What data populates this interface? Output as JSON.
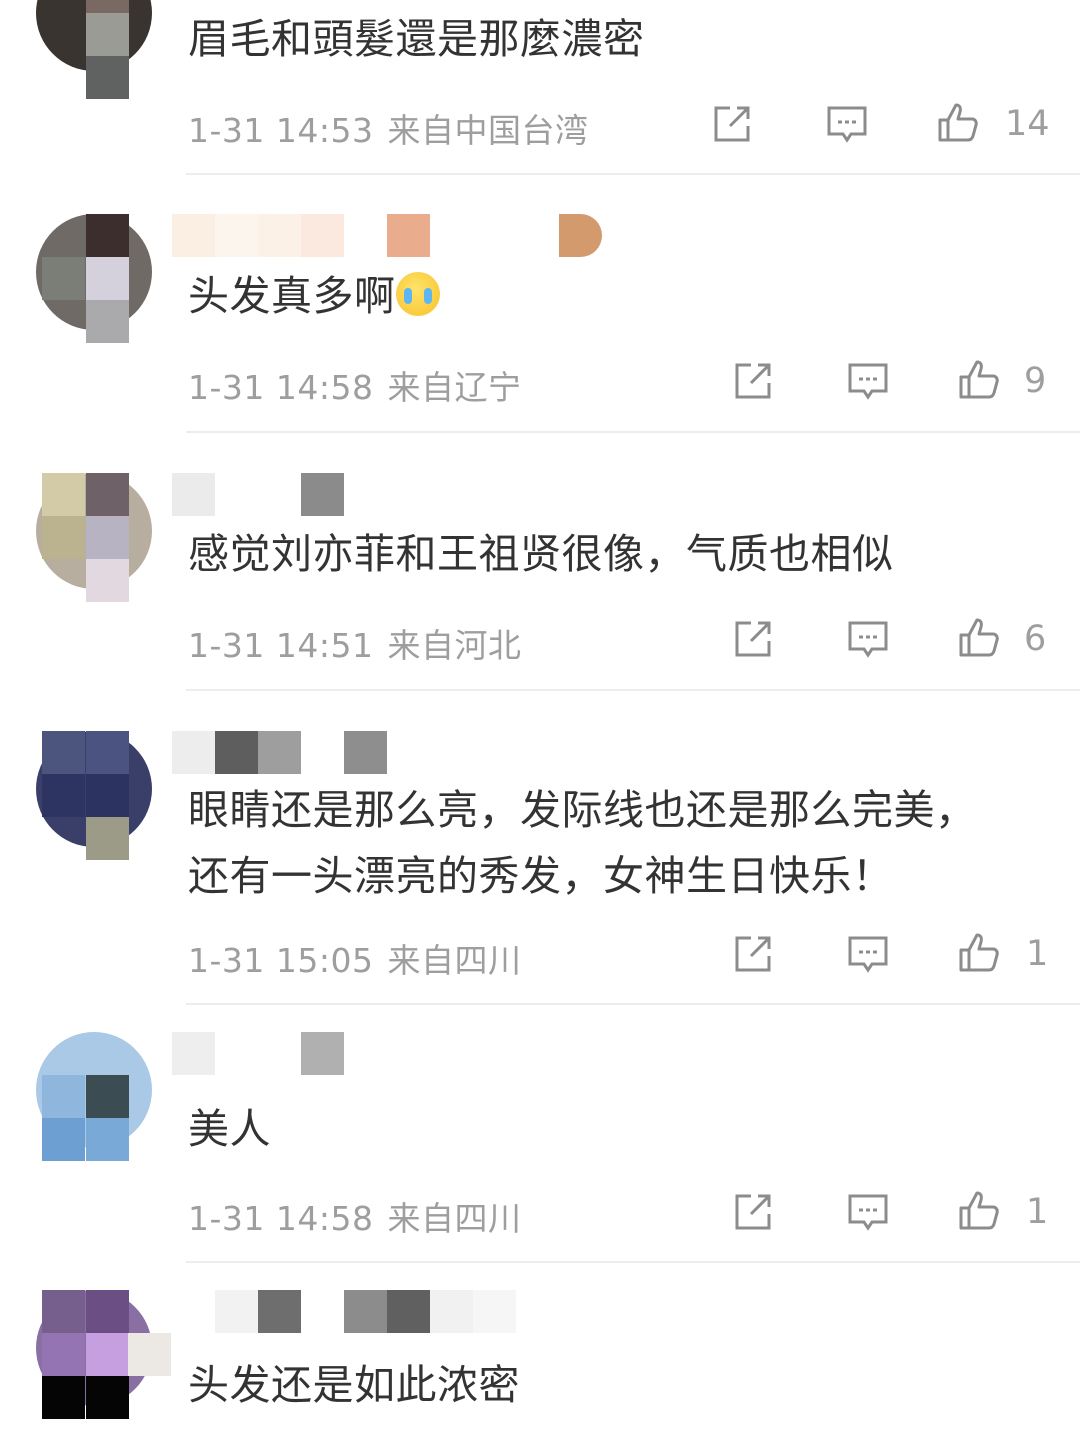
{
  "comments": [
    {
      "text": "眉毛和頭髮還是那麼濃密",
      "time": "1-31 14:53",
      "location": "来自中国台湾",
      "likes": "14"
    },
    {
      "text": "头发真多啊",
      "time": "1-31 14:58",
      "location": "来自辽宁",
      "likes": "9",
      "emoji": "crying-face"
    },
    {
      "text": "感觉刘亦菲和王祖贤很像，气质也相似",
      "time": "1-31 14:51",
      "location": "来自河北",
      "likes": "6"
    },
    {
      "text": "眼睛还是那么亮，发际线也还是那么完美，\n还有一头漂亮的秀发，女神生日快乐！",
      "time": "1-31 15:05",
      "location": "来自四川",
      "likes": "1"
    },
    {
      "text": "美人",
      "time": "1-31 14:58",
      "location": "来自四川",
      "likes": "1"
    },
    {
      "text": "头发还是如此浓密"
    }
  ],
  "icons": {
    "share": "share-icon",
    "reply": "comment-icon",
    "like": "thumbs-up-icon"
  },
  "colors": {
    "text": "#333333",
    "meta": "#9e9e9e",
    "divider": "#ededed"
  }
}
